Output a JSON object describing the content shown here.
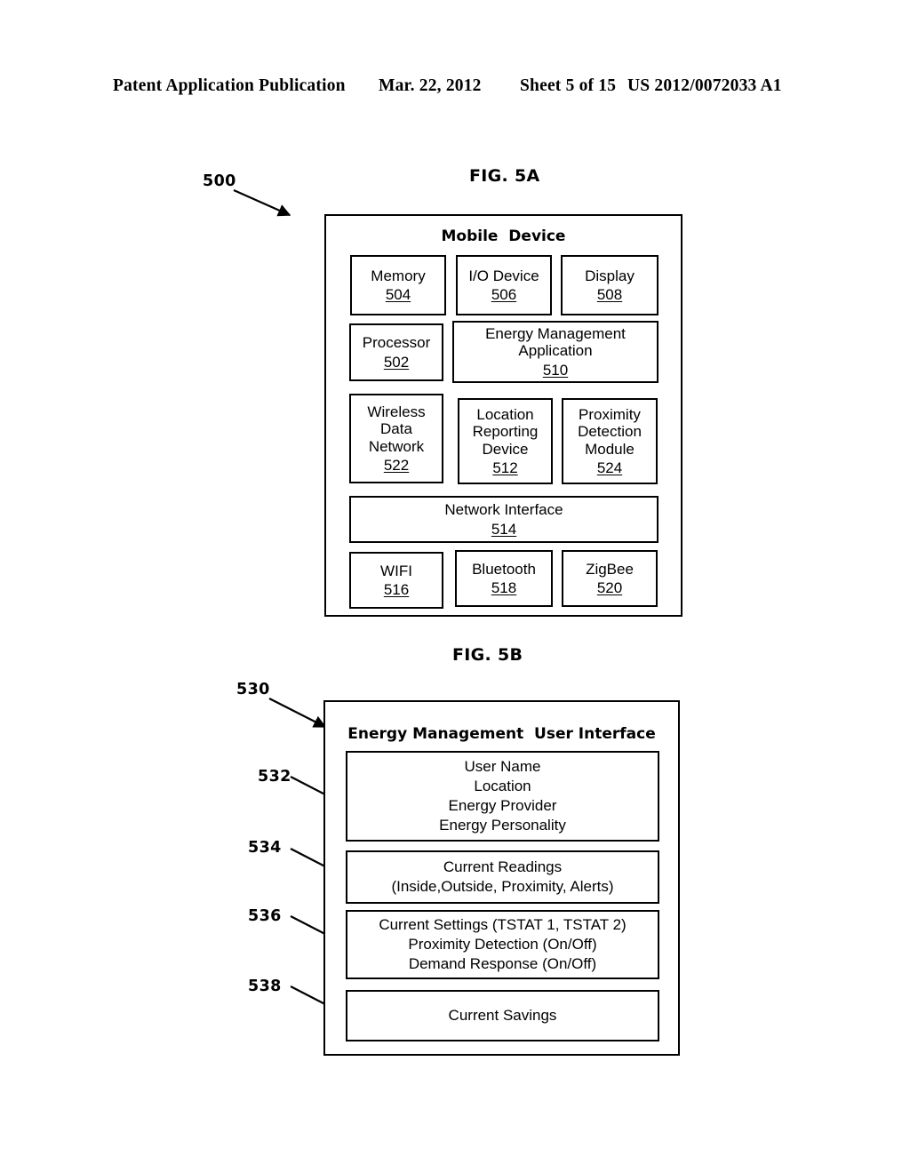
{
  "header": {
    "publication": "Patent Application Publication",
    "date": "Mar. 22, 2012",
    "sheet": "Sheet 5 of 15",
    "patent_number": "US 2012/0072033 A1"
  },
  "figures": [
    {
      "id": "fig5a",
      "title": "FIG. 5A",
      "ref": "500",
      "container_title": "Mobile  Device",
      "blocks": [
        {
          "label": "Memory",
          "num": "504"
        },
        {
          "label": "I/O Device",
          "num": "506"
        },
        {
          "label": "Display",
          "num": "508"
        },
        {
          "label": "Processor",
          "num": "502"
        },
        {
          "label": "Energy Management\nApplication",
          "num": "510"
        },
        {
          "label": "Wireless\nData\nNetwork",
          "num": "522"
        },
        {
          "label": "Location\nReporting\nDevice",
          "num": "512"
        },
        {
          "label": "Proximity\nDetection\nModule",
          "num": "524"
        },
        {
          "label": "Network Interface",
          "num": "514"
        },
        {
          "label": "WIFI",
          "num": "516"
        },
        {
          "label": "Bluetooth",
          "num": "518"
        },
        {
          "label": "ZigBee",
          "num": "520"
        }
      ]
    },
    {
      "id": "fig5b",
      "title": "FIG. 5B",
      "ref": "530",
      "container_title": "Energy Management  User Interface",
      "panels": [
        {
          "ref": "532",
          "lines": [
            "User Name",
            "Location",
            "Energy Provider",
            "Energy Personality"
          ]
        },
        {
          "ref": "534",
          "lines": [
            "Current Readings",
            "(Inside,Outside, Proximity, Alerts)"
          ]
        },
        {
          "ref": "536",
          "lines": [
            "Current Settings (TSTAT 1, TSTAT 2)",
            "Proximity Detection (On/Off)",
            "Demand Response (On/Off)"
          ]
        },
        {
          "ref": "538",
          "lines": [
            "Current Savings"
          ]
        }
      ]
    }
  ]
}
